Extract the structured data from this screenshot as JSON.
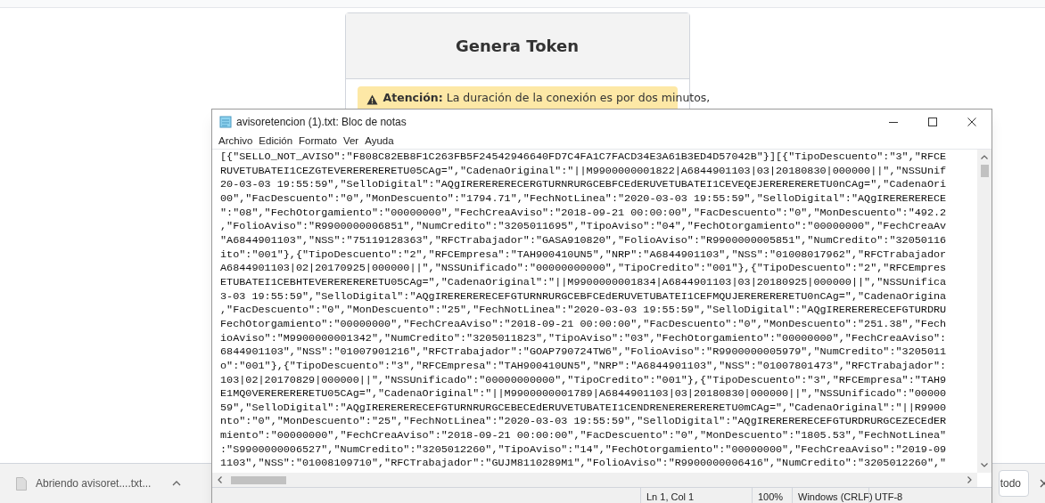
{
  "web_page": {
    "card": {
      "title": "Genera Token",
      "alert": "**Atención:** La duración de la conexión es por dos minutos,"
    }
  },
  "download_bar": {
    "item": "Abriendo avisoret....txt...",
    "show_all": "todo"
  },
  "notepad": {
    "title": "avisoretencion (1).txt: Bloc de notas",
    "menu": [
      "Archivo",
      "Edición",
      "Formato",
      "Ver",
      "Ayuda"
    ],
    "lines": [
      "[{\"SELLO_NOT_AVISO\":\"F808C82EB8F1C263FB5F24542946640FD7C4FA1C7FACD34E3A61B3ED4D57042B\"}][{\"TipoDescuento\":\"3\",\"RFCE",
      "RUVETUBATEI1CEZGTEVERERERERETU05CAg=\",\"CadenaOriginal\":\"||M9900000001822|A6844901103|03|20180830|000000||\",\"NSSUnif",
      "20-03-03 19:55:59\",\"SelloDigital\":\"AQgIRERERERECERGTURNRURGCEBFCEdERUVETUBATEI1CEVEQEJERERERERETU0nCAg=\",\"CadenaOri",
      "00\",\"FacDescuento\":\"0\",\"MonDescuento\":\"1794.71\",\"FechNotLinea\":\"2020-03-03 19:55:59\",\"SelloDigital\":\"AQgIRERERERECE",
      "\":\"08\",\"FechOtorgamiento\":\"00000000\",\"FechCreaAviso\":\"2018-09-21 00:00:00\",\"FacDescuento\":\"0\",\"MonDescuento\":\"492.2",
      ",\"FolioAviso\":\"R9900000006851\",\"NumCredito\":\"3205011695\",\"TipoAviso\":\"04\",\"FechOtorgamiento\":\"00000000\",\"FechCreaAv",
      "\"A6844901103\",\"NSS\":\"75119128363\",\"RFCTrabajador\":\"GASA910820\",\"FolioAviso\":\"R9900000005851\",\"NumCredito\":\"32050116",
      "ito\":\"001\"},{\"TipoDescuento\":\"2\",\"RFCEmpresa\":\"TAH900410UN5\",\"NRP\":\"A6844901103\",\"NSS\":\"01008017962\",\"RFCTrabajador",
      "A6844901103|02|20170925|000000||\",\"NSSUnificado\":\"00000000000\",\"TipoCredito\":\"001\"},{\"TipoDescuento\":\"2\",\"RFCEmpres",
      "ETUBATEI1CEBHTEVERERERERETU05CAg=\",\"CadenaOriginal\":\"||M9900000001834|A6844901103|03|20180925|000000||\",\"NSSUnifica",
      "3-03 19:55:59\",\"SelloDigital\":\"AQgIRERERERECEFGTURNRURGCEBFCEdERUVETUBATEI1CEFMQUJERERERERETU0nCAg=\",\"CadenaOrigina",
      ",\"FacDescuento\":\"0\",\"MonDescuento\":\"25\",\"FechNotLinea\":\"2020-03-03 19:55:59\",\"SelloDigital\":\"AQgIRERERERECEFGTURDRU",
      "FechOtorgamiento\":\"00000000\",\"FechCreaAviso\":\"2018-09-21 00:00:00\",\"FacDescuento\":\"0\",\"MonDescuento\":\"251.38\",\"Fech",
      "ioAviso\":\"M9900000001342\",\"NumCredito\":\"3205011823\",\"TipoAviso\":\"03\",\"FechOtorgamiento\":\"00000000\",\"FechCreaAviso\":",
      "6844901103\",\"NSS\":\"01007901216\",\"RFCTrabajador\":\"GOAP790724TW6\",\"FolioAviso\":\"R9900000005979\",\"NumCredito\":\"3205011",
      "o\":\"001\"},{\"TipoDescuento\":\"3\",\"RFCEmpresa\":\"TAH900410UN5\",\"NRP\":\"A6844901103\",\"NSS\":\"01007801473\",\"RFCTrabajador\":",
      "103|02|20170829|000000||\",\"NSSUnificado\":\"00000000000\",\"TipoCredito\":\"001\"},{\"TipoDescuento\":\"3\",\"RFCEmpresa\":\"TAH9",
      "E1MQ0VERERERERETU05CAg=\",\"CadenaOriginal\":\"||M9900000001789|A6844901103|03|20180830|000000||\",\"NSSUnificado\":\"00000",
      "59\",\"SelloDigital\":\"AQgIRERERERECEFGTURNRURGCEBECEdERUVETUBATEI1CENDRENERERERERETU0mCAg=\",\"CadenaOriginal\":\"||R9900",
      "nto\":\"0\",\"MonDescuento\":\"25\",\"FechNotLinea\":\"2020-03-03 19:55:59\",\"SelloDigital\":\"AQgIRERERERECEFGTURDRURGCEZECEdER",
      "miento\":\"00000000\",\"FechCreaAviso\":\"2018-09-21 00:00:00\",\"FacDescuento\":\"0\",\"MonDescuento\":\"1805.53\",\"FechNotLinea\"",
      ":\"S9900000006527\",\"NumCredito\":\"3205012260\",\"TipoAviso\":\"14\",\"FechOtorgamiento\":\"00000000\",\"FechCreaAviso\":\"2019-09",
      "1103\",\"NSS\":\"01008109710\",\"RFCTrabajador\":\"GUJM8110289M1\",\"FolioAviso\":\"R9900000006416\",\"NumCredito\":\"3205012260\",\""
    ],
    "status_bar": [
      "Ln 1, Col 1",
      "100%",
      "Windows (CRLF)",
      "UTF-8"
    ]
  }
}
